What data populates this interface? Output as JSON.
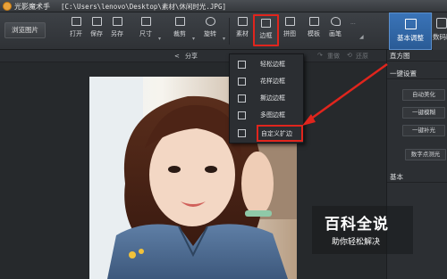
{
  "window": {
    "app_title": "光影魔术手",
    "file_path": "[C:\\Users\\lenovo\\Desktop\\素材\\休闲时光.JPG]"
  },
  "toolbar": {
    "browse_label": "浏览图片",
    "tools": [
      {
        "name": "open",
        "label": "打开",
        "icon": "folder-icon"
      },
      {
        "name": "save",
        "label": "保存",
        "icon": "save-icon"
      },
      {
        "name": "save-as",
        "label": "另存",
        "icon": "save-as-icon"
      },
      {
        "name": "size",
        "label": "尺寸",
        "icon": "resize-icon"
      },
      {
        "name": "crop",
        "label": "裁剪",
        "icon": "crop-icon"
      },
      {
        "name": "rotate",
        "label": "旋转",
        "icon": "rotate-icon"
      },
      {
        "name": "material",
        "label": "素材",
        "icon": "material-icon"
      },
      {
        "name": "border",
        "label": "边框",
        "icon": "border-icon"
      },
      {
        "name": "collage",
        "label": "拼图",
        "icon": "collage-icon"
      },
      {
        "name": "template",
        "label": "模板",
        "icon": "template-icon"
      },
      {
        "name": "draw",
        "label": "画笔",
        "icon": "pen-icon"
      }
    ]
  },
  "right_tabs": {
    "basic": "基本调整",
    "beauty": "数码暗房"
  },
  "subbar": {
    "share": "分享",
    "redo": "重做",
    "restore": "还原"
  },
  "dropdown": {
    "items": [
      {
        "label": "轻松边框",
        "icon": "border-simple-icon"
      },
      {
        "label": "花样边框",
        "icon": "border-pattern-icon"
      },
      {
        "label": "撕边边框",
        "icon": "border-torn-icon"
      },
      {
        "label": "多图边框",
        "icon": "border-multi-icon"
      },
      {
        "label": "自定义扩边",
        "icon": "border-custom-icon"
      }
    ]
  },
  "panel": {
    "histogram": "直方图",
    "one_click": "一键设置",
    "buttons": [
      "自动美化",
      "一键模糊",
      "一键补光",
      "数字点测光"
    ],
    "basic": "基本"
  },
  "watermark": {
    "title": "百科全说",
    "subtitle": "助你轻松解决"
  },
  "colors": {
    "highlight": "#e0251d",
    "active_tab": "#3a74b8"
  }
}
